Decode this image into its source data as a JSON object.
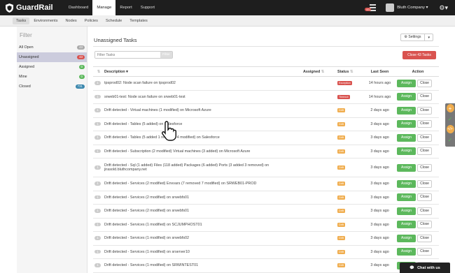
{
  "app": {
    "name": "GuardRail"
  },
  "nav": {
    "items": [
      "Dashboard",
      "Manage",
      "Report",
      "Support"
    ],
    "active": "Manage"
  },
  "header": {
    "task_badge": "43",
    "company": "Bluth Company"
  },
  "subnav": {
    "items": [
      "Tasks",
      "Environments",
      "Nodes",
      "Policies",
      "Schedule",
      "Templates"
    ],
    "active": "Tasks"
  },
  "sidebar": {
    "title": "Filter",
    "items": [
      {
        "label": "All Open",
        "count": "43",
        "color": "#aaaaaa"
      },
      {
        "label": "Unassigned",
        "count": "43",
        "color": "#d9534f"
      },
      {
        "label": "Assigned",
        "count": "0",
        "color": "#5cb85c"
      },
      {
        "label": "Mine",
        "count": "0",
        "color": "#5cb85c"
      },
      {
        "label": "Closed",
        "count": "731",
        "color": "#3a87ad"
      }
    ]
  },
  "main": {
    "title": "Unassigned Tasks",
    "settings_label": "Settings",
    "filter_placeholder": "Filter Tasks",
    "filter_button": "Filter",
    "close_all": "Close 43 Tasks"
  },
  "table": {
    "headers": [
      "Description",
      "Assigned",
      "Status",
      "Last Seen",
      "Action"
    ],
    "assign_label": "Assign",
    "close_label": "Close",
    "rows": [
      {
        "num": "1",
        "desc": "tpsprod02: Node scan failure on tpsprod02",
        "status": "Exception",
        "status_color": "#d9534f",
        "seen": "14 hours ago"
      },
      {
        "num": "1",
        "desc": "srweb01-test: Node scan failure on srweb01-test",
        "status": "Timeout",
        "status_color": "#d9534f",
        "seen": "14 hours ago"
      },
      {
        "num": "1",
        "desc": "Drift detected - Virtual machines (1 modified) on Microsoft Azure",
        "status": "Drift",
        "status_color": "#f0ad4e",
        "seen": "2 days ago"
      },
      {
        "num": "1",
        "desc": "Drift detected - Tables (5 added) on Salesforce",
        "status": "Drift",
        "status_color": "#f0ad4e",
        "seen": "3 days ago"
      },
      {
        "num": "1",
        "desc": "Drift detected - Tables (5 added 1 removed 4 modified) on Salesforce",
        "status": "Drift",
        "status_color": "#f0ad4e",
        "seen": "3 days ago"
      },
      {
        "num": "1",
        "desc": "Drift detected - Subscription (2 modified) Virtual machines (3 added) on Microsoft Azure",
        "status": "Drift",
        "status_color": "#f0ad4e",
        "seen": "3 days ago"
      },
      {
        "num": "1",
        "desc": "Drift detected - Sql (1 added) Files (118 added) Packages (6 added) Ports (3 added 3 removed) on jirasold.bluthcompany.net",
        "status": "Drift",
        "status_color": "#f0ad4e",
        "seen": "3 days ago",
        "tall": true
      },
      {
        "num": "1",
        "desc": "Drift detected - Services (2 modified) Envvars (7 removed 7 modified) on SRWEB01-PROD",
        "status": "Drift",
        "status_color": "#f0ad4e",
        "seen": "3 days ago"
      },
      {
        "num": "1",
        "desc": "Drift detected - Services (2 modified) on srwebfs01",
        "status": "Drift",
        "status_color": "#f0ad4e",
        "seen": "3 days ago"
      },
      {
        "num": "1",
        "desc": "Drift detected - Services (2 modified) on srwebfs01",
        "status": "Drift",
        "status_color": "#f0ad4e",
        "seen": "3 days ago"
      },
      {
        "num": "1",
        "desc": "Drift detected - Services (1 modified) on SCJUMPHOST01",
        "status": "Drift",
        "status_color": "#f0ad4e",
        "seen": "3 days ago"
      },
      {
        "num": "1",
        "desc": "Drift detected - Services (1 modified) on srwebfs02",
        "status": "Drift",
        "status_color": "#f0ad4e",
        "seen": "3 days ago"
      },
      {
        "num": "1",
        "desc": "Drift detected - Services (1 modified) on srserver10",
        "status": "Drift",
        "status_color": "#f0ad4e",
        "seen": "3 days ago"
      },
      {
        "num": "1",
        "desc": "Drift detected - Services (1 modified) on SRWINTEST01",
        "status": "Drift",
        "status_color": "#f0ad4e",
        "seen": "3 days ago"
      }
    ]
  },
  "chat": {
    "label": "Chat with us"
  },
  "colors": {
    "topbar": "#1e1e1e",
    "assign": "#5cb85c",
    "danger": "#d9534f",
    "drift": "#f0ad4e",
    "closed": "#3a87ad"
  }
}
